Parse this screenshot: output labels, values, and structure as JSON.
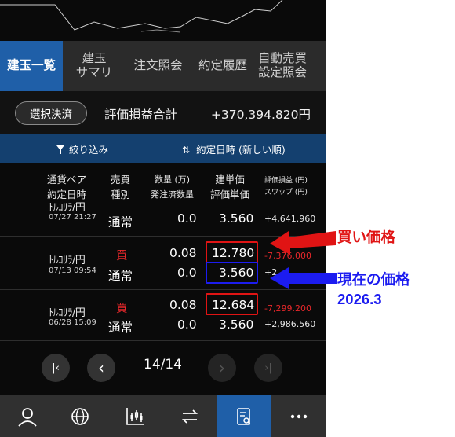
{
  "tabs": [
    {
      "label": "建玉一覧",
      "active": true
    },
    {
      "label": "建玉\nサマリ",
      "active": false
    },
    {
      "label": "注文照会",
      "active": false
    },
    {
      "label": "約定履歴",
      "active": false
    },
    {
      "label": "自動売買\n設定照会",
      "active": false
    }
  ],
  "summary": {
    "button": "選択決済",
    "label": "評価損益合計",
    "value": "+370,394.820円"
  },
  "filter": {
    "filter_label": "絞り込み",
    "sort_label": "約定日時 (新しい順)"
  },
  "columns": {
    "pair_date": "通貨ペア\n約定日時",
    "side_type": "売買\n種別",
    "qty": "数量 (万)\n発注済数量",
    "price": "建単価\n評価単価",
    "pl_swap": "評価損益 (円)\nスワップ (円)"
  },
  "rows": [
    {
      "pair": "ﾄﾙｺﾘﾗ/円",
      "date": "07/27 21:27",
      "side": "",
      "type": "通常",
      "qty": "",
      "pending": "0.0",
      "open_price": "",
      "eval_price": "3.560",
      "pl": "",
      "swap": "+4,641.960"
    },
    {
      "pair": "ﾄﾙｺﾘﾗ/円",
      "date": "07/13 09:54",
      "side": "買",
      "type": "通常",
      "qty": "0.08",
      "pending": "0.0",
      "open_price": "12.780",
      "eval_price": "3.560",
      "pl": "-7,376.000",
      "swap": "+2,"
    },
    {
      "pair": "ﾄﾙｺﾘﾗ/円",
      "date": "06/28 15:09",
      "side": "買",
      "type": "通常",
      "qty": "0.08",
      "pending": "0.0",
      "open_price": "12.684",
      "eval_price": "3.560",
      "pl": "-7,299.200",
      "swap": "+2,986.560"
    }
  ],
  "pager": {
    "text": "14/14",
    "first": "|‹",
    "prev": "‹",
    "next": "›",
    "last": "›|"
  },
  "bottom_nav": [
    {
      "icon": "person-icon",
      "active": false
    },
    {
      "icon": "globe-icon",
      "active": false
    },
    {
      "icon": "chart-icon",
      "active": false
    },
    {
      "icon": "swap-icon",
      "active": false
    },
    {
      "icon": "document-search-icon",
      "active": true
    },
    {
      "icon": "more-icon",
      "active": false
    }
  ],
  "annotations": {
    "buy_price": "買い価格",
    "current_price": "現在の価格",
    "current_date": "2026.3",
    "red": "#e01414",
    "blue": "#1c1cf0"
  }
}
